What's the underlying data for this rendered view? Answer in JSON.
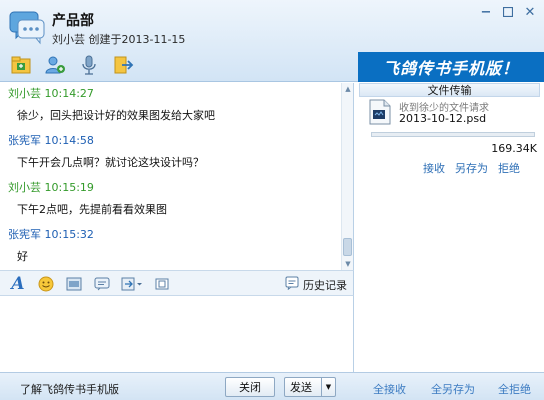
{
  "window": {
    "title": "产品部",
    "subtitle": "刘小芸 创建于2013-11-15"
  },
  "toolbar": {
    "icons": [
      "file-share-icon",
      "add-member-icon",
      "voice-icon",
      "exit-icon"
    ]
  },
  "banner": {
    "text": "飞鸽传书手机版！"
  },
  "messages": [
    {
      "sender": "刘小芸",
      "time": "10:14:27",
      "meta": "刘小芸 10:14:27",
      "text": "徐少，回头把设计好的效果图发给大家吧",
      "color": "#339a2a"
    },
    {
      "sender": "张宪军",
      "time": "10:14:58",
      "meta": "张宪军 10:14:58",
      "text": "下午开会几点啊？就讨论这块设计吗？",
      "color": "#1e5fb3"
    },
    {
      "sender": "刘小芸",
      "time": "10:15:19",
      "meta": "刘小芸 10:15:19",
      "text": "下午2点吧，先提前看看效果图",
      "color": "#339a2a"
    },
    {
      "sender": "张宪军",
      "time": "10:15:32",
      "meta": "张宪军 10:15:32",
      "text": "好",
      "color": "#1e5fb3"
    }
  ],
  "input_toolbar": {
    "history_label": "历史记录"
  },
  "input": {
    "value": ""
  },
  "file_panel": {
    "header": "文件传输",
    "request": "收到徐少的文件请求",
    "filename": "2013-10-12.psd",
    "size": "169.34K",
    "progress": 0,
    "accept": "接收",
    "save_as": "另存为",
    "reject": "拒绝"
  },
  "bottom": {
    "learn_link": "了解飞鸽传书手机版",
    "close_label": "关闭",
    "send_label": "发送",
    "accept_all": "全接收",
    "save_all": "全另存为",
    "reject_all": "全拒绝"
  },
  "colors": {
    "banner_bg": "#0a6fc2",
    "link": "#3d7cc2",
    "green_sender": "#339a2a",
    "blue_sender": "#1e5fb3"
  }
}
